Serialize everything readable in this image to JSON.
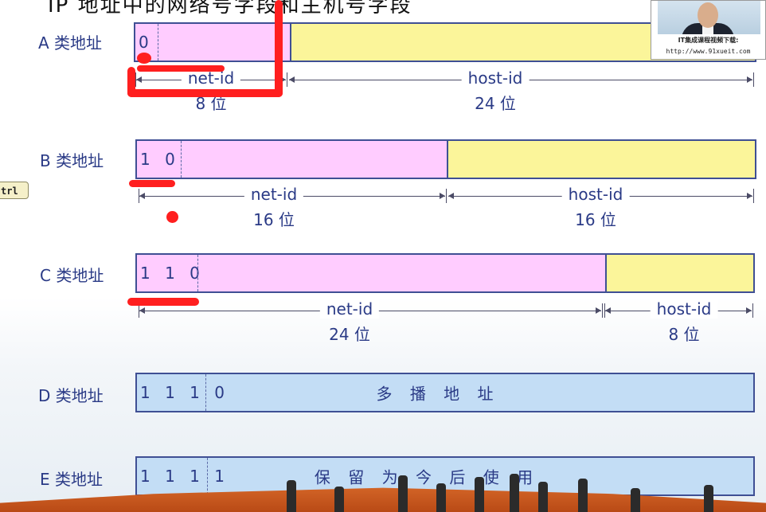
{
  "title_fragment": "IP 地址中的网络号字段和主机号字段",
  "rows": {
    "A": {
      "label": "A 类地址",
      "bits": "0",
      "net_label": "net-id",
      "net_bits": "8 位",
      "host_label": "host-id",
      "host_bits": "24 位"
    },
    "B": {
      "label": "B 类地址",
      "bits": "1 0",
      "net_label": "net-id",
      "net_bits": "16 位",
      "host_label": "host-id",
      "host_bits": "16 位"
    },
    "C": {
      "label": "C 类地址",
      "bits": "1 1 0",
      "net_label": "net-id",
      "net_bits": "24 位",
      "host_label": "host-id",
      "host_bits": "8 位"
    },
    "D": {
      "label": "D 类地址",
      "bits": "1 1 1 0",
      "text": "多 播 地 址"
    },
    "E": {
      "label": "E 类地址",
      "bits": "1 1 1 1",
      "text": "保 留 为 今 后 使 用"
    }
  },
  "ctrl_tag": "trl",
  "video": {
    "caption": "IT集成课程视频下载:",
    "url": "http://www.91xueit.com"
  },
  "colors": {
    "net_segment": "#ffccff",
    "host_segment": "#fbf59a",
    "reserved_segment": "#c3ddf5",
    "border": "#3f4f94",
    "text": "#2a3a86",
    "annotation_red": "#ff1f1f"
  },
  "icons": {
    "presenter": "presenter-photo-icon",
    "pen_marks": "red-pen-stroke-icon"
  }
}
